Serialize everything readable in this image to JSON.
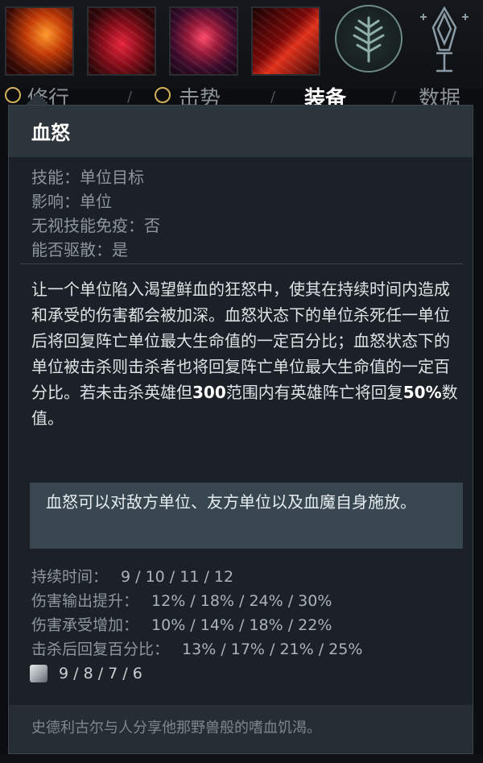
{
  "tabs": {
    "tab1": "修行",
    "tab2": "击势",
    "tab3": "装备",
    "tab4": "数据"
  },
  "abilities": [
    {
      "icon": "ability-blood-axe-icon"
    },
    {
      "icon": "ability-blood-ring-icon"
    },
    {
      "icon": "ability-bloodrage-icon"
    },
    {
      "icon": "ability-rupture-icon"
    }
  ],
  "tooltip": {
    "title": "血怒",
    "props": {
      "p1": "技能：单位目标",
      "p2": "影响：单位",
      "p3": "无视技能免疫：否",
      "p4": "能否驱散：是"
    },
    "description": {
      "part1": "让一个单位陷入渴望鲜血的狂怒中，使其在持续时间内造成和承受的伤害都会被加深。血怒状态下的单位杀死任一单位后将回复阵亡单位最大生命值的一定百分比；血怒状态下的单位被击杀则击杀者也将回复阵亡单位最大生命值的一定百分比。若未击杀英雄但",
      "num1": "300",
      "part2": "范围内有英雄阵亡将回复",
      "num2": "50%",
      "part3": "数值。"
    },
    "note": "血怒可以对敌方单位、友方单位以及血魔自身施放。",
    "stats": {
      "duration_label": "持续时间：",
      "duration_value": "9 / 10 / 11 / 12",
      "dmg_out_label": "伤害输出提升：",
      "dmg_out_value": "12% / 18% / 24% / 30%",
      "dmg_in_label": "伤害承受增加：",
      "dmg_in_value": "10% / 14% / 18% / 22%",
      "heal_label": "击杀后回复百分比：",
      "heal_value": "13% / 17% / 21% / 25%"
    },
    "cooldown": "9 / 8 / 7 / 6",
    "lore": "史德利古尔与人分享他那野兽般的嗜血饥渴。"
  },
  "colors": {
    "panel_bg": "#1b2126",
    "header_bg": "#2d353c",
    "note_bg": "#38464f",
    "label_gray": "#8e979e"
  }
}
